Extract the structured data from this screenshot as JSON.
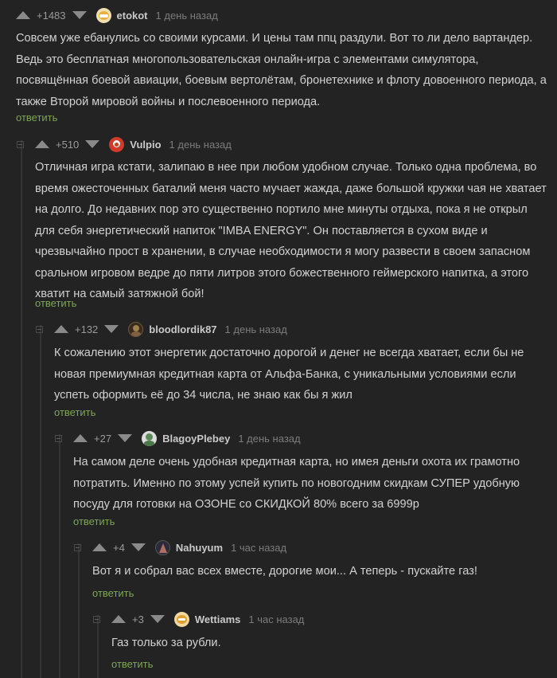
{
  "comments": [
    {
      "rating": "+1483",
      "user": "etokot",
      "time": "1 день назад",
      "text": "Совсем уже ебанулись со своими курсами. И цены там ппц раздули. Вот то ли дело вартандер. Ведь это бесплатная многопользовательская онлайн-игра с элементами симулятора, посвящённая боевой авиации, боевым вертолётам, бронетехнике и флоту довоенного периода, а также Второй мировой войны и послевоенного периода.",
      "reply": "ответить"
    },
    {
      "rating": "+510",
      "user": "Vulpio",
      "time": "1 день назад",
      "text": "Отличная игра кстати, залипаю в нее при любом удобном случае. Только одна проблема, во время ожесточенных баталий меня часто мучает жажда, даже большой кружки чая не хватает на долго. До недавних пор это существенно портило мне минуты отдыха, пока я не открыл для себя энергетический напиток \"IMBA ENERGY\". Он поставляется в сухом виде и чрезвычайно прост в хранении, в случае необходимости я могу развести в своем запасном сральном игровом ведре до пяти литров этого божественного геймерского напитка, а этого хватит на самый затяжной бой!",
      "reply": "ответить"
    },
    {
      "rating": "+132",
      "user": "bloodlordik87",
      "time": "1 день назад",
      "text": "К сожалению этот энергетик достаточно дорогой и денег не всегда хватает, если бы не новая премиумная кредитная карта от Альфа-Банка, с уникальными условиями если успеть оформить её до 34 числа, не знаю как бы я жил",
      "reply": "ответить"
    },
    {
      "rating": "+27",
      "user": "BlagoyPlebey",
      "time": "1 день назад",
      "text": "На самом деле очень удобная кредитная карта, но имея деньги охота их грамотно потратить. Именно по этому успей купить по новогодним скидкам СУПЕР удобную посуду для готовки на ОЗОНЕ со СКИДКОЙ 80% всего за 6999р",
      "reply": "ответить"
    },
    {
      "rating": "+4",
      "user": "Nahuyum",
      "time": "1 час назад",
      "text": "Вот я и собрал вас всех вместе, дорогие мои... А теперь - пускайте газ!",
      "reply": "ответить"
    },
    {
      "rating": "+3",
      "user": "Wettiams",
      "time": "1 час назад",
      "text": "Газ только за рубли.",
      "reply": "ответить"
    }
  ],
  "colors": {
    "background": "#232323",
    "text": "#d2d2d2",
    "reply": "#7ea55a",
    "meta": "#7c7c7c"
  }
}
